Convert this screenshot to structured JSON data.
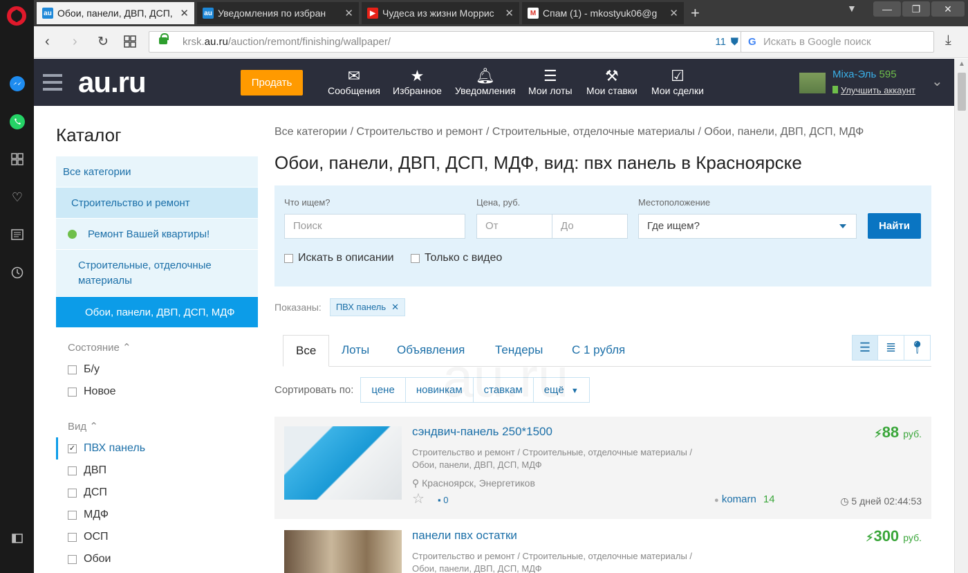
{
  "browser": {
    "tabs": [
      {
        "label": "Обои, панели, ДВП, ДСП,",
        "active": true
      },
      {
        "label": "Уведомления по избран",
        "active": false
      },
      {
        "label": "Чудеса из жизни Моррис",
        "active": false
      },
      {
        "label": "Спам (1) - mkostyuk06@g",
        "active": false
      }
    ],
    "url_host": "krsk.",
    "url_domain": "au.ru",
    "url_path": "/auction/remont/finishing/wallpaper/",
    "shield_count": "11",
    "search_placeholder": "Искать в Google поиск"
  },
  "header": {
    "logo": "au.ru",
    "sell_label": "Продать",
    "nav": [
      "Сообщения",
      "Избранное",
      "Уведомления",
      "Мои лоты",
      "Мои ставки",
      "Мои сделки"
    ],
    "user_name": "Міха-Эль",
    "user_score": "595",
    "upgrade_label": "Улучшить аккаунт"
  },
  "catalog": {
    "title": "Каталог",
    "items": [
      "Все категории",
      "Строительство и ремонт",
      "Ремонт Вашей квартиры!",
      "Строительные, отделочные материалы",
      "Обои, панели, ДВП, ДСП, МДФ"
    ],
    "state_title": "Состояние",
    "state_options": [
      "Б/у",
      "Новое"
    ],
    "kind_title": "Вид",
    "kind_options": [
      "ПВХ панель",
      "ДВП",
      "ДСП",
      "МДФ",
      "ОСП",
      "Обои"
    ]
  },
  "main": {
    "breadcrumb": "Все категории / Строительство и ремонт / Строительные, отделочные материалы / Обои, панели, ДВП, ДСП, МДФ",
    "title": "Обои, панели, ДВП, ДСП, МДФ, вид: пвх панель в Красноярске",
    "search": {
      "what_label": "Что ищем?",
      "what_placeholder": "Поиск",
      "price_label": "Цена, руб.",
      "from_placeholder": "От",
      "to_placeholder": "До",
      "location_label": "Местоположение",
      "location_value": "Где ищем?",
      "find_label": "Найти",
      "in_desc_label": "Искать в описании",
      "video_label": "Только с видео"
    },
    "shown_label": "Показаны:",
    "chip": "ПВХ панель",
    "tabs": [
      "Все",
      "Лоты",
      "Объявления",
      "Тендеры",
      "С 1 рубля"
    ],
    "sort_label": "Сортировать по:",
    "sort_options": [
      "цене",
      "новинкам",
      "ставкам",
      "ещё"
    ]
  },
  "lots": [
    {
      "title": "сэндвич-панель 250*1500",
      "category": "Строительство и ремонт / Строительные, отделочные материалы / Обои, панели, ДВП, ДСП, МДФ",
      "location": "Красноярск, Энергетиков",
      "price": "88",
      "currency": "руб.",
      "comments": "0",
      "seller": "komarn",
      "rating": "14",
      "time_left": "5 дней 02:44:53"
    },
    {
      "title": "панели пвх остатки",
      "category": "Строительство и ремонт / Строительные, отделочные материалы / Обои, панели, ДВП, ДСП, МДФ",
      "price": "300",
      "currency": "руб."
    }
  ],
  "colors": {
    "accent": "#0c9ce8",
    "header_bg": "#2b2e3b",
    "sell": "#ff9a00",
    "price": "#3aa63a"
  }
}
